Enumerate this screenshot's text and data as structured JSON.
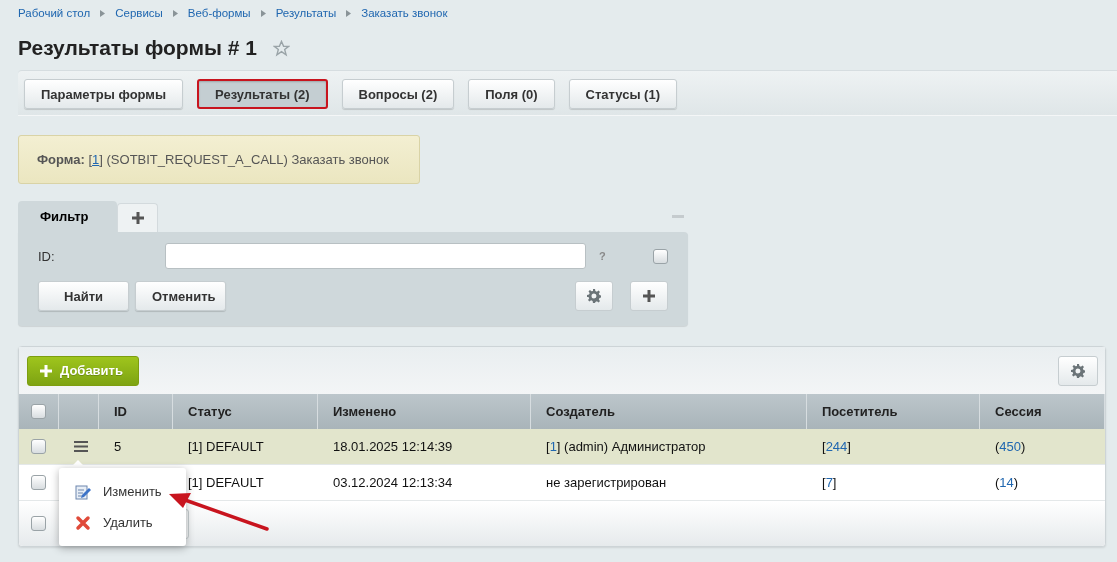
{
  "breadcrumbs": [
    "Рабочий стол",
    "Сервисы",
    "Веб-формы",
    "Результаты",
    "Заказать звонок"
  ],
  "title": "Результаты формы # 1",
  "favorite": false,
  "tabs": [
    {
      "label": "Параметры формы",
      "selected": false
    },
    {
      "label": "Результаты (2)",
      "selected": true
    },
    {
      "label": "Вопросы (2)",
      "selected": false
    },
    {
      "label": "Поля (0)",
      "selected": false
    },
    {
      "label": "Статусы (1)",
      "selected": false
    }
  ],
  "info": {
    "label": "Форма:",
    "pre": "[",
    "link": "1",
    "post": "] (SOTBIT_REQUEST_A_CALL) Заказать звонок"
  },
  "filter": {
    "tab": "Фильтр",
    "field_label": "ID:",
    "help": "?",
    "checked": false,
    "buttons": [
      "Найти",
      "Отменить"
    ]
  },
  "add_button": "Добавить",
  "table": {
    "select_all_checked": false,
    "footer_checked": false,
    "columns": [
      "ID",
      "Статус",
      "Изменено",
      "Создатель",
      "Посетитель",
      "Сессия"
    ],
    "rows": [
      {
        "selected": true,
        "checked": false,
        "cells": [
          {
            "text": "5"
          },
          {
            "text": "[1] DEFAULT"
          },
          {
            "text": "18.01.2025 12:14:39"
          },
          {
            "pre": "[",
            "link": "1",
            "post": "] (admin) Администратор"
          },
          {
            "pre": "[",
            "link": "244",
            "post": "]"
          },
          {
            "pre": "(",
            "link": "450",
            "post": ")"
          }
        ]
      },
      {
        "selected": false,
        "checked": false,
        "cells": [
          null,
          {
            "text": "[1] DEFAULT"
          },
          {
            "text": "03.12.2024 12:13:34"
          },
          {
            "text": "не зарегистрирован"
          },
          {
            "pre": "[",
            "link": "7",
            "post": "]"
          },
          {
            "pre": "(",
            "link": "14",
            "post": ")"
          }
        ]
      }
    ]
  },
  "context_menu": [
    {
      "kind": "edit",
      "label": "Изменить"
    },
    {
      "kind": "delete",
      "label": "Удалить"
    }
  ]
}
